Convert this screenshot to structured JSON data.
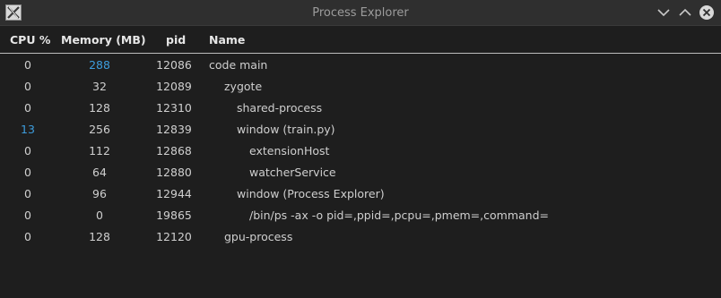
{
  "window": {
    "title": "Process Explorer",
    "icon": "x-window-icon"
  },
  "controls": {
    "minimize_icon": "chevron-down-icon",
    "maximize_icon": "chevron-up-icon",
    "close_icon": "close-icon"
  },
  "columns": {
    "cpu": "CPU %",
    "memory": "Memory (MB)",
    "pid": "pid",
    "name": "Name"
  },
  "colors": {
    "accent": "#3d9cdc",
    "background": "#1e1e1e",
    "titlebar": "#2f2f2f"
  },
  "rows": [
    {
      "cpu": "0",
      "memory": "288",
      "pid": "12086",
      "name": "code main",
      "depth": 0,
      "highlight": "memory"
    },
    {
      "cpu": "0",
      "memory": "32",
      "pid": "12089",
      "name": "zygote",
      "depth": 1,
      "highlight": ""
    },
    {
      "cpu": "0",
      "memory": "128",
      "pid": "12310",
      "name": "shared-process",
      "depth": 2,
      "highlight": ""
    },
    {
      "cpu": "13",
      "memory": "256",
      "pid": "12839",
      "name": "window (train.py)",
      "depth": 2,
      "highlight": "cpu"
    },
    {
      "cpu": "0",
      "memory": "112",
      "pid": "12868",
      "name": "extensionHost",
      "depth": 3,
      "highlight": ""
    },
    {
      "cpu": "0",
      "memory": "64",
      "pid": "12880",
      "name": "watcherService",
      "depth": 3,
      "highlight": ""
    },
    {
      "cpu": "0",
      "memory": "96",
      "pid": "12944",
      "name": "window (Process Explorer)",
      "depth": 2,
      "highlight": ""
    },
    {
      "cpu": "0",
      "memory": "0",
      "pid": "19865",
      "name": "/bin/ps -ax -o pid=,ppid=,pcpu=,pmem=,command=",
      "depth": 3,
      "highlight": ""
    },
    {
      "cpu": "0",
      "memory": "128",
      "pid": "12120",
      "name": "gpu-process",
      "depth": 1,
      "highlight": ""
    }
  ]
}
